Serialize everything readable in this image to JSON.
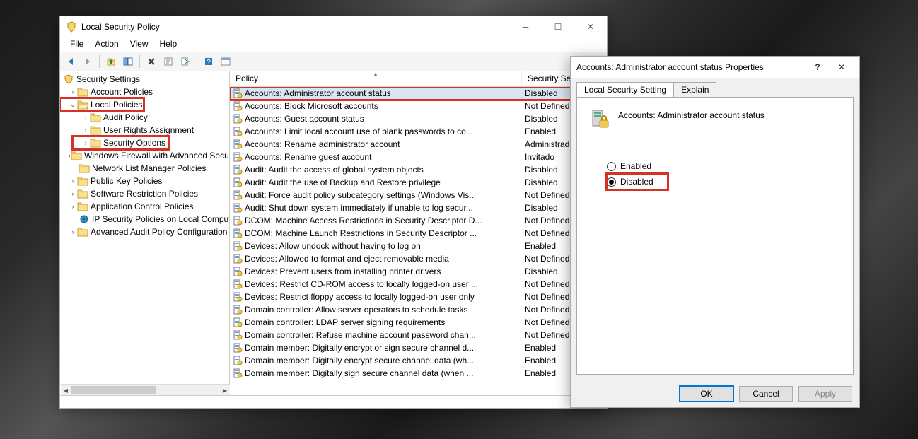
{
  "window": {
    "title": "Local Security Policy",
    "menu": {
      "file": "File",
      "action": "Action",
      "view": "View",
      "help": "Help"
    }
  },
  "tree": {
    "root": "Security Settings",
    "items": [
      {
        "label": "Account Policies"
      },
      {
        "label": "Local Policies"
      },
      {
        "label": "Audit Policy"
      },
      {
        "label": "User Rights Assignment"
      },
      {
        "label": "Security Options"
      },
      {
        "label": "Windows Firewall with Advanced Security"
      },
      {
        "label": "Network List Manager Policies"
      },
      {
        "label": "Public Key Policies"
      },
      {
        "label": "Software Restriction Policies"
      },
      {
        "label": "Application Control Policies"
      },
      {
        "label": "IP Security Policies on Local Computer"
      },
      {
        "label": "Advanced Audit Policy Configuration"
      }
    ]
  },
  "list": {
    "col_policy": "Policy",
    "col_setting": "Security Setting",
    "rows": [
      {
        "p": "Accounts: Administrator account status",
        "s": "Disabled"
      },
      {
        "p": "Accounts: Block Microsoft accounts",
        "s": "Not Defined"
      },
      {
        "p": "Accounts: Guest account status",
        "s": "Disabled"
      },
      {
        "p": "Accounts: Limit local account use of blank passwords to co...",
        "s": "Enabled"
      },
      {
        "p": "Accounts: Rename administrator account",
        "s": "Administrador"
      },
      {
        "p": "Accounts: Rename guest account",
        "s": "Invitado"
      },
      {
        "p": "Audit: Audit the access of global system objects",
        "s": "Disabled"
      },
      {
        "p": "Audit: Audit the use of Backup and Restore privilege",
        "s": "Disabled"
      },
      {
        "p": "Audit: Force audit policy subcategory settings (Windows Vis...",
        "s": "Not Defined"
      },
      {
        "p": "Audit: Shut down system immediately if unable to log secur...",
        "s": "Disabled"
      },
      {
        "p": "DCOM: Machine Access Restrictions in Security Descriptor D...",
        "s": "Not Defined"
      },
      {
        "p": "DCOM: Machine Launch Restrictions in Security Descriptor ...",
        "s": "Not Defined"
      },
      {
        "p": "Devices: Allow undock without having to log on",
        "s": "Enabled"
      },
      {
        "p": "Devices: Allowed to format and eject removable media",
        "s": "Not Defined"
      },
      {
        "p": "Devices: Prevent users from installing printer drivers",
        "s": "Disabled"
      },
      {
        "p": "Devices: Restrict CD-ROM access to locally logged-on user ...",
        "s": "Not Defined"
      },
      {
        "p": "Devices: Restrict floppy access to locally logged-on user only",
        "s": "Not Defined"
      },
      {
        "p": "Domain controller: Allow server operators to schedule tasks",
        "s": "Not Defined"
      },
      {
        "p": "Domain controller: LDAP server signing requirements",
        "s": "Not Defined"
      },
      {
        "p": "Domain controller: Refuse machine account password chan...",
        "s": "Not Defined"
      },
      {
        "p": "Domain member: Digitally encrypt or sign secure channel d...",
        "s": "Enabled"
      },
      {
        "p": "Domain member: Digitally encrypt secure channel data (wh...",
        "s": "Enabled"
      },
      {
        "p": "Domain member: Digitally sign secure channel data (when ...",
        "s": "Enabled"
      }
    ]
  },
  "dialog": {
    "title": "Accounts: Administrator account status Properties",
    "tab1": "Local Security Setting",
    "tab2": "Explain",
    "heading": "Accounts: Administrator account status",
    "opt_enabled": "Enabled",
    "opt_disabled": "Disabled",
    "btn_ok": "OK",
    "btn_cancel": "Cancel",
    "btn_apply": "Apply"
  }
}
